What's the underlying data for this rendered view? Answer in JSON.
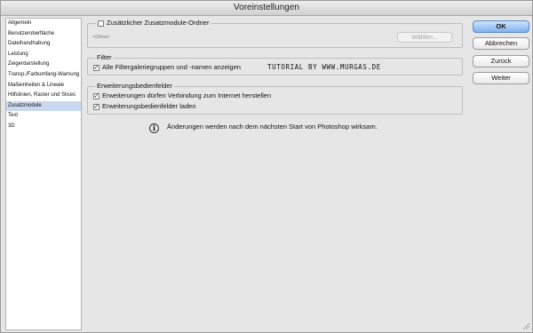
{
  "window": {
    "title": "Voreinstellungen"
  },
  "sidebar": {
    "items": [
      {
        "label": "Allgemein",
        "selected": false
      },
      {
        "label": "Benutzeroberfläche",
        "selected": false
      },
      {
        "label": "Dateihandhabung",
        "selected": false
      },
      {
        "label": "Leistung",
        "selected": false
      },
      {
        "label": "Zeigerdarstellung",
        "selected": false
      },
      {
        "label": "Transp./Farbumfang-Warnung",
        "selected": false
      },
      {
        "label": "Maßeinheiten & Lineale",
        "selected": false
      },
      {
        "label": "Hilfslinien, Raster und Slices",
        "selected": false
      },
      {
        "label": "Zusatzmodule",
        "selected": true
      },
      {
        "label": "Text",
        "selected": false
      },
      {
        "label": "3D",
        "selected": false
      }
    ]
  },
  "plugins": {
    "additional_folder": {
      "label": "Zusätzlicher Zusatzmodule-Ordner",
      "checked": false
    },
    "path_placeholder": "<Ohne>",
    "choose_button": "Wählen..."
  },
  "filter": {
    "title": "Filter",
    "show_all": {
      "label": "Alle Filtergaleriegruppen und -namen anzeigen",
      "checked": true
    }
  },
  "watermark": "TUTORIAL BY WWW.MURGAS.DE",
  "extensions": {
    "title": "Erweiterungsbedienfelder",
    "items": [
      {
        "label": "Erweiterungen dürfen Verbindung zum Internet herstellen",
        "checked": true
      },
      {
        "label": "Erweiterungsbedienfelder laden",
        "checked": true
      }
    ]
  },
  "info": {
    "icon": "info-icon",
    "text": "Änderungen werden nach dem nächsten Start von Photoshop wirksam."
  },
  "buttons": {
    "ok": "OK",
    "cancel": "Abbrechen",
    "back": "Zurück",
    "next": "Weiter"
  },
  "colors": {
    "selection": "#c9d8ef",
    "primary_button": "#7db2ee"
  }
}
